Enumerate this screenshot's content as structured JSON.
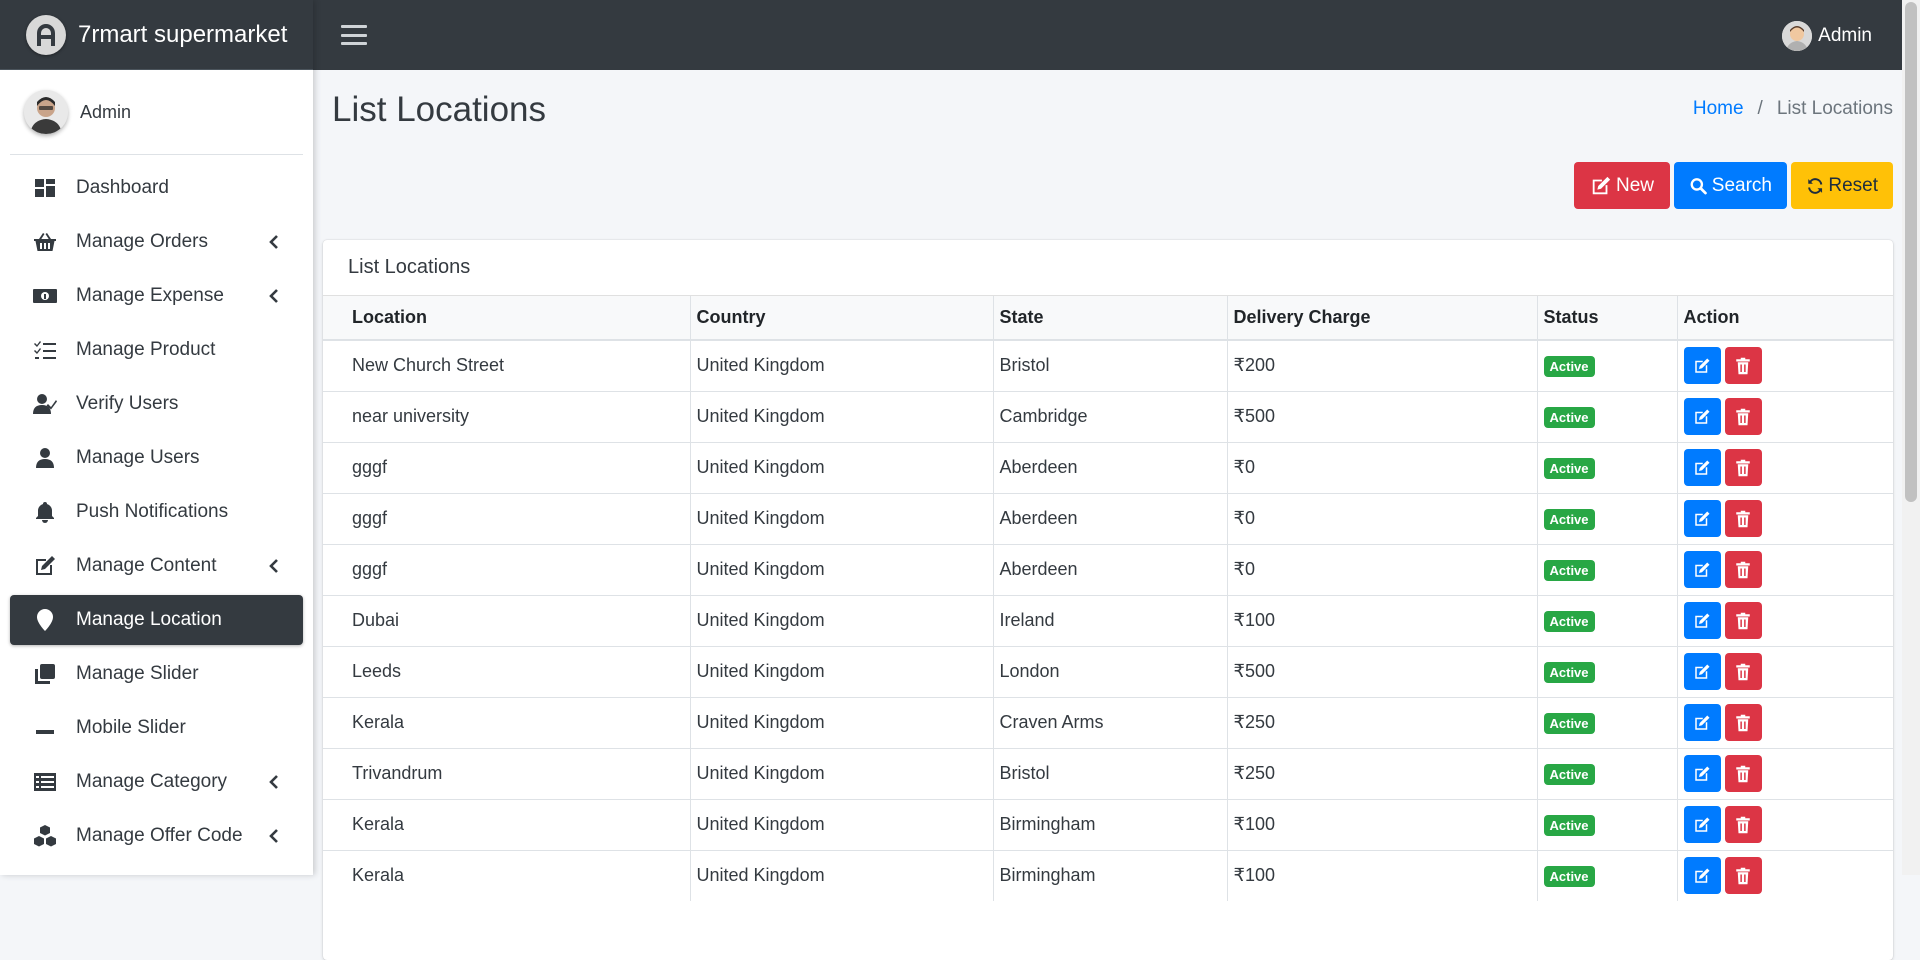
{
  "brand": {
    "title": "7rmart supermarket"
  },
  "sidebar": {
    "user_name": "Admin",
    "items": [
      {
        "label": "Dashboard",
        "icon": "dashboard-icon",
        "has_arrow": false,
        "active": false
      },
      {
        "label": "Manage Orders",
        "icon": "basket-icon",
        "has_arrow": true,
        "active": false
      },
      {
        "label": "Manage Expense",
        "icon": "money-icon",
        "has_arrow": true,
        "active": false
      },
      {
        "label": "Manage Product",
        "icon": "tasks-icon",
        "has_arrow": false,
        "active": false
      },
      {
        "label": "Verify Users",
        "icon": "user-check-icon",
        "has_arrow": false,
        "active": false
      },
      {
        "label": "Manage Users",
        "icon": "user-icon",
        "has_arrow": false,
        "active": false
      },
      {
        "label": "Push Notifications",
        "icon": "bell-icon",
        "has_arrow": false,
        "active": false
      },
      {
        "label": "Manage Content",
        "icon": "edit-icon",
        "has_arrow": true,
        "active": false
      },
      {
        "label": "Manage Location",
        "icon": "map-marker-icon",
        "has_arrow": false,
        "active": true
      },
      {
        "label": "Manage Slider",
        "icon": "clone-icon",
        "has_arrow": false,
        "active": false
      },
      {
        "label": "Mobile Slider",
        "icon": "minus-icon",
        "has_arrow": false,
        "active": false
      },
      {
        "label": "Manage Category",
        "icon": "list-icon",
        "has_arrow": true,
        "active": false
      },
      {
        "label": "Manage Offer Code",
        "icon": "cubes-icon",
        "has_arrow": true,
        "active": false
      }
    ]
  },
  "topbar": {
    "user_name": "Admin"
  },
  "page": {
    "title": "List Locations",
    "breadcrumb": {
      "home": "Home",
      "separator": "/",
      "current": "List Locations"
    }
  },
  "buttons": {
    "new": "New",
    "search": "Search",
    "reset": "Reset"
  },
  "card": {
    "title": "List Locations"
  },
  "table": {
    "columns": [
      "Location",
      "Country",
      "State",
      "Delivery Charge",
      "Status",
      "Action"
    ],
    "rows": [
      [
        "New Church Street",
        "United Kingdom",
        "Bristol",
        "₹200",
        "Active"
      ],
      [
        "near university",
        "United Kingdom",
        "Cambridge",
        "₹500",
        "Active"
      ],
      [
        "gggf",
        "United Kingdom",
        "Aberdeen",
        "₹0",
        "Active"
      ],
      [
        "gggf",
        "United Kingdom",
        "Aberdeen",
        "₹0",
        "Active"
      ],
      [
        "gggf",
        "United Kingdom",
        "Aberdeen",
        "₹0",
        "Active"
      ],
      [
        "Dubai",
        "United Kingdom",
        "Ireland",
        "₹100",
        "Active"
      ],
      [
        "Leeds",
        "United Kingdom",
        "London",
        "₹500",
        "Active"
      ],
      [
        "Kerala",
        "United Kingdom",
        "Craven Arms",
        "₹250",
        "Active"
      ],
      [
        "Trivandrum",
        "United Kingdom",
        "Bristol",
        "₹250",
        "Active"
      ],
      [
        "Kerala",
        "United Kingdom",
        "Birmingham",
        "₹100",
        "Active"
      ],
      [
        "Kerala",
        "United Kingdom",
        "Birmingham",
        "₹100",
        "Active"
      ]
    ]
  },
  "colors": {
    "dark": "#343a40",
    "primary": "#007bff",
    "danger": "#dc3545",
    "warning": "#ffc107",
    "success": "#28a745"
  }
}
